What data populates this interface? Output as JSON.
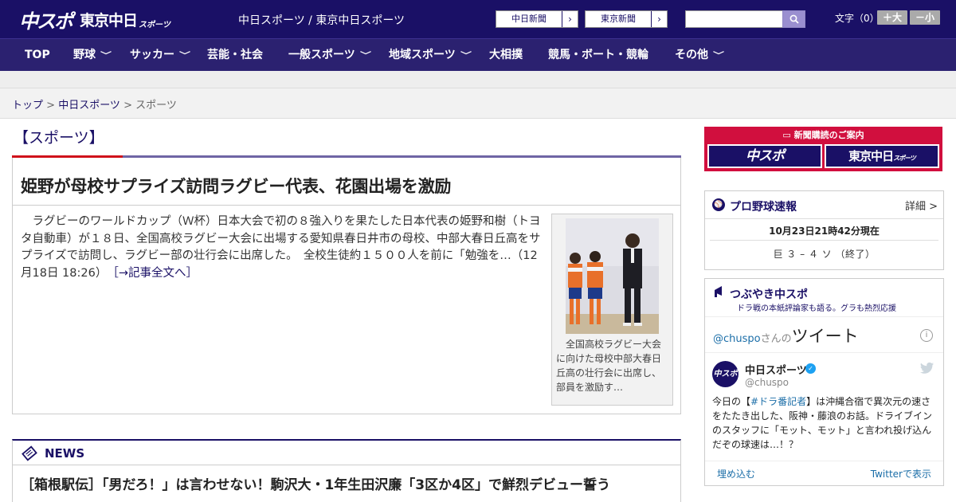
{
  "header": {
    "logo_main": "中スポ",
    "logo_sub": "東京中日",
    "logo_tail": "スポーツ",
    "site_title": "中日スポーツ / 東京中日スポーツ",
    "btn_chunichi": "中日新聞",
    "btn_tokyo": "東京新聞",
    "arrow": "›",
    "search_placeholder": "",
    "font_label": "文字（0）",
    "font_plus": "＋大",
    "font_minus": "－小"
  },
  "nav": {
    "top": "TOP",
    "yakyu": "野球",
    "soccer": "サッカー",
    "geino": "芸能・社会",
    "ippan": "一般スポーツ",
    "chiiki": "地域スポーツ",
    "sumo": "大相撲",
    "keiba": "競馬・ボート・競輪",
    "sonota": "その他",
    "chev": "﹀"
  },
  "breadcrumb": {
    "home": "トップ",
    "sep": " > ",
    "level1": "中日スポーツ",
    "current": "スポーツ"
  },
  "section": {
    "title": "【スポーツ】"
  },
  "article": {
    "headline": "姫野が母校サプライズ訪問ラグビー代表、花園出場を激励",
    "body": "　ラグビーのワールドカップ（Ｗ杯）日本大会で初の８強入りを果たした日本代表の姫野和樹（トヨタ自動車）が１８日、全国高校ラグビー大会に出場する愛知県春日井市の母校、中部大春日丘高をサプライズで訪問し、ラグビー部の壮行会に出席した。　全校生徒約１５００人を前に「勉強を…（12月18日 18:26）",
    "more": "［→記事全文へ］",
    "caption": "　全国高校ラグビー大会に向けた母校中部大春日丘高の壮行会に出席し、部員を激励す…"
  },
  "news": {
    "label": "NEWS",
    "item1": "［箱根駅伝］「男だろ！」は言わせない！駒沢大・1年生田沢廉「3区か4区」で鮮烈デビュー誓う"
  },
  "subscribe": {
    "title": "新聞購読のご案内",
    "btn_a": "中スポ",
    "btn_b": "東京中日",
    "btn_b_small": "スポーツ"
  },
  "baseball": {
    "title": "プロ野球速報",
    "detail": "詳細 >",
    "timestamp": "10月23日21時42分現在",
    "score": "巨 ３ – ４ ソ （終了）"
  },
  "tweet": {
    "title": "つぶやき中スポ",
    "subtitle": "ドラ戦の本紙評論家も語る。グラも熱烈応援",
    "handle_prefix": "@chuspo",
    "san": "さんの",
    "tweets_word": "ツイート",
    "account_name": "中日スポーツ",
    "account_handle": "@chuspo",
    "text_pre": "今日の【",
    "hashtag": "#ドラ番記者",
    "text_post": "】は沖縄合宿で異次元の速さをたたき出した、阪神・藤浪のお話。ドライブインのスタッフに「モット、モット」と言われ投げ込んだぞの球速は…！？",
    "embed": "埋め込む",
    "view": "Twitterで表示",
    "avatar_text": "中スポ",
    "info": "i"
  },
  "colors": {
    "brand_navy": "#1a1066",
    "nav_bg": "#2b2170",
    "accent_red": "#d0121b",
    "subscribe_red": "#d10f3e",
    "link_blue": "#1b6ea8"
  }
}
